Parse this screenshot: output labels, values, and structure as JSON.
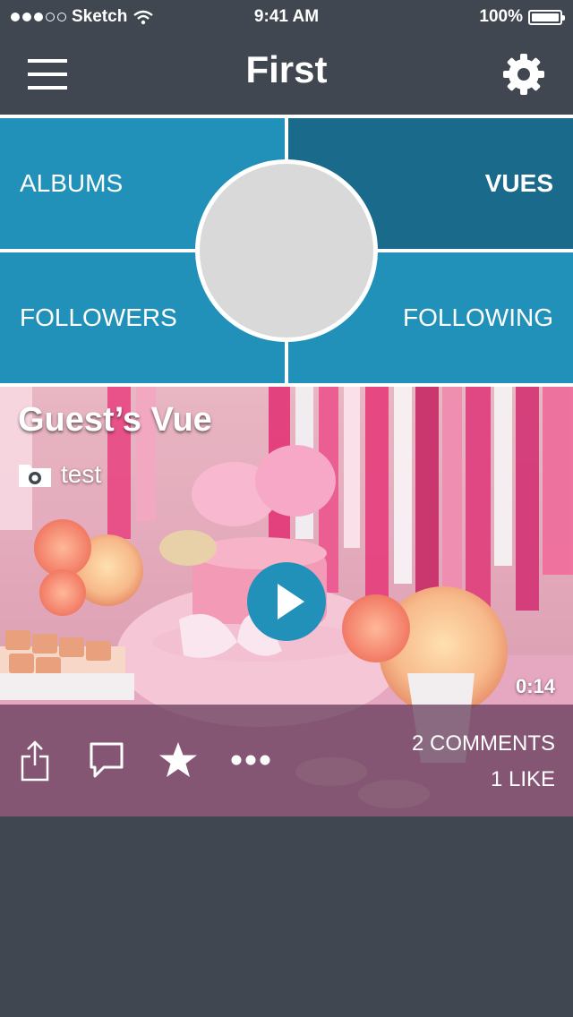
{
  "status_bar": {
    "carrier": "Sketch",
    "time": "9:41 AM",
    "battery": "100%",
    "signal_bars_filled": 3,
    "signal_bars_total": 5
  },
  "nav": {
    "title": "First",
    "left_icon": "hamburger-menu-icon",
    "right_icon": "gear-icon"
  },
  "profile_grid": {
    "albums_label": "ALBUMS",
    "vues_label": "VUES",
    "followers_label": "FOLLOWERS",
    "following_label": "FOLLOWING",
    "selected": "VUES"
  },
  "vue_card": {
    "title": "Guest’s Vue",
    "album_icon": "camera-folder-icon",
    "album_name": "test",
    "duration": "0:14",
    "comments": "2 COMMENTS",
    "likes": "1 LIKE",
    "actions": [
      "share-icon",
      "comment-icon",
      "star-icon",
      "more-icon"
    ]
  },
  "colors": {
    "background": "#414750",
    "accent": "#2291b9",
    "selected_tile": "#1a6a8c"
  }
}
